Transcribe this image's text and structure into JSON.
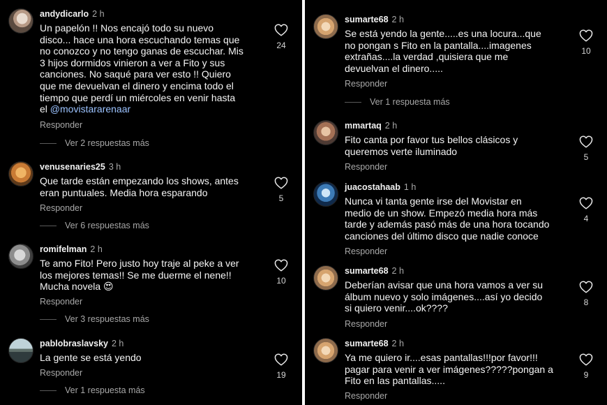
{
  "ui": {
    "reply_label": "Responder"
  },
  "left_comments": [
    {
      "user": "andydicarlo",
      "time": "2 h",
      "lines": [
        "Un papelón !! Nos encajó todo su nuevo",
        "disco... hace una hora escuchando temas que",
        "no conozco y no tengo ganas de escuchar. Mis",
        "3 hijos dormidos vinieron a ver a Fito y sus",
        "canciones. No saqué para ver esto !! Quiero",
        "que me devuelvan el dinero y encima todo el",
        "tiempo que perdí un miércoles en venir hasta"
      ],
      "last_line_prefix": "el ",
      "mention": "@movistararenaar",
      "likes": "24",
      "more": "Ver 2 respuestas más"
    },
    {
      "user": "venusenaries25",
      "time": "3 h",
      "lines": [
        "Que tarde están empezando los shows, antes",
        "eran puntuales. Media hora esparando"
      ],
      "likes": "5",
      "more": "Ver 6 respuestas más"
    },
    {
      "user": "romifelman",
      "time": "2 h",
      "lines": [
        "Te amo Fito! Pero justo hoy traje al peke a ver",
        "los mejores temas!! Se me duerme el nene!!",
        "Mucha novela 😍"
      ],
      "likes": "10",
      "more": "Ver 3 respuestas más"
    },
    {
      "user": "pablobraslavsky",
      "time": "2 h",
      "lines": [
        "La gente se está yendo"
      ],
      "likes": "19",
      "more": "Ver 1 respuesta más"
    }
  ],
  "right_comments": [
    {
      "user": "sumarte68",
      "time": "2 h",
      "lines": [
        "Se está yendo la gente.....es una locura...que",
        "no pongan s Fito en la pantalla....imagenes",
        "extrañas....la verdad ,quisiera que me",
        "devuelvan el dinero....."
      ],
      "likes": "10",
      "more": "Ver 1 respuesta más"
    },
    {
      "user": "mmartaq",
      "time": "2 h",
      "lines": [
        "Fito canta por favor  tus bellos clásicos y",
        "queremos verte iluminado"
      ],
      "likes": "5"
    },
    {
      "user": "juacostahaab",
      "time": "1 h",
      "lines": [
        "Nunca vi tanta gente irse del Movistar en",
        "medio de un show. Empezó media hora más",
        "tarde y además pasó más de una hora tocando",
        "canciones del último disco que nadie conoce"
      ],
      "likes": "4"
    },
    {
      "user": "sumarte68",
      "time": "2 h",
      "lines": [
        "Deberían avisar que una hora vamos a ver su",
        "álbum nuevo y solo imágenes....así yo decido",
        "si quiero venir....ok????"
      ],
      "likes": "8"
    },
    {
      "user": "sumarte68",
      "time": "2 h",
      "lines": [
        "Ya me quiero ir....esas pantallas!!!por favor!!!",
        "pagar para venir a ver imágenes?????pongan a",
        "Fito en las pantallas....."
      ],
      "likes": "9"
    }
  ]
}
